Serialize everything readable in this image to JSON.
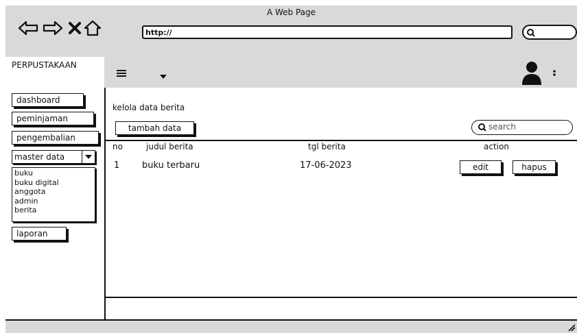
{
  "window": {
    "title": "A Web Page"
  },
  "browser": {
    "url": "http://"
  },
  "sidebar": {
    "brand": "PERPUSTAKAAN",
    "items": [
      "dashboard",
      "peminjaman",
      "pengembalian"
    ],
    "master_label": "master data",
    "master_options": [
      "buku",
      "buku digital",
      "anggota",
      "admin",
      "berita"
    ],
    "report_label": "laporan"
  },
  "main": {
    "title": "kelola data berita",
    "add_label": "tambah data",
    "search_placeholder": "search",
    "columns": [
      "no",
      "judul berita",
      "tgl berita",
      "action"
    ],
    "rows": [
      {
        "no": "1",
        "judul": "buku terbaru",
        "tgl": "17-06-2023",
        "edit": "edit",
        "hapus": "hapus"
      }
    ]
  }
}
